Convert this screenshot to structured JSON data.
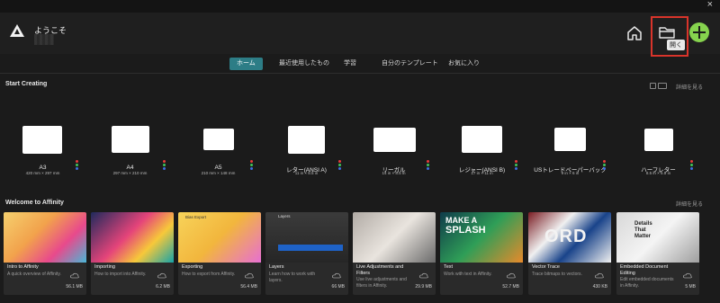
{
  "window": {
    "close_glyph": "×"
  },
  "header": {
    "welcome": "ようこそ",
    "open_tooltip": "開く"
  },
  "tabs": [
    {
      "label": "ホーム",
      "active": true
    },
    {
      "label": "最近使用したもの",
      "active": false
    },
    {
      "label": "学習",
      "active": false
    },
    {
      "label": "自分のテンプレート",
      "active": false
    },
    {
      "label": "お気に入り",
      "active": false
    }
  ],
  "start": {
    "title": "Start Creating",
    "see_more": "詳細を見る",
    "presets": [
      {
        "name": "A3",
        "dims": "420 mm × 297 mm"
      },
      {
        "name": "A4",
        "dims": "297 mm × 210 mm"
      },
      {
        "name": "A5",
        "dims": "210 mm × 148 mm"
      },
      {
        "name": "レター(ANSI A)",
        "dims": "11 in × 8.5 in"
      },
      {
        "name": "リーガル",
        "dims": "14 in × 8.5 in"
      },
      {
        "name": "レジャー(ANSI B)",
        "dims": "17 in × 11 in"
      },
      {
        "name": "USトレードペーパーバック",
        "dims": "9 in × 6 in"
      },
      {
        "name": "ハーフレター",
        "dims": "8.5 in × 5.5 in"
      }
    ]
  },
  "welcome_section": {
    "title": "Welcome to Affinity",
    "see_more": "詳細を見る",
    "cards": [
      {
        "title": "Intro to Affinity",
        "desc": "A quick overview of Affinity.",
        "size": "56.1 MB"
      },
      {
        "title": "Importing",
        "desc": "How to import into Affinity.",
        "size": "6.2 MB"
      },
      {
        "title": "Exporting",
        "desc": "How to export from Affinity.",
        "size": "56.4 MB"
      },
      {
        "title": "Layers",
        "desc": "Learn how to work with layers.",
        "size": "66 MB"
      },
      {
        "title": "Live Adjustments and Filters",
        "desc": "Use live adjustments and filters in Affinity.",
        "size": "29.9 MB"
      },
      {
        "title": "Text",
        "desc": "Work with text in Affinity.",
        "size": "52.7 MB"
      },
      {
        "title": "Vector Trace",
        "desc": "Trace bitmaps to vectors.",
        "size": "430 KB"
      },
      {
        "title": "Embedded Document Editing",
        "desc": "Edit embedded documents in Affinity.",
        "size": "5 MB"
      }
    ]
  },
  "thumb_text": {
    "export_panel": "Bias Export",
    "layers_panel": "Layers",
    "make_a_splash_1": "MAKE A",
    "make_a_splash_2": "SPLASH",
    "ord": "ORD",
    "details_1": "Details",
    "details_2": "That",
    "details_3": "Matter"
  },
  "colors": {
    "accent": "#2d7d86",
    "new_button": "#86d34e",
    "highlight": "#d9342b",
    "dot_red": "#e53b3b",
    "dot_green": "#3fc45a",
    "dot_blue": "#3d6fe0"
  }
}
